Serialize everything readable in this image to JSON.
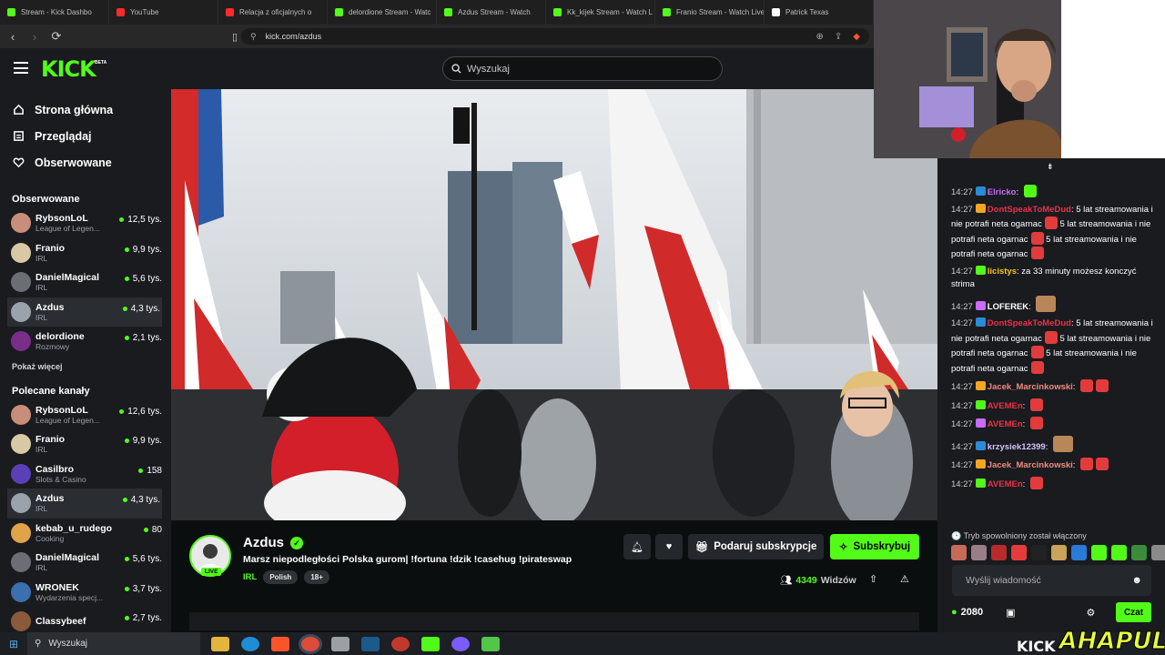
{
  "browser": {
    "tabs": [
      {
        "label": "Stream - Kick Dashbo",
        "color": "#53fc18"
      },
      {
        "label": "YouTube",
        "color": "#ff2a2a"
      },
      {
        "label": "Relacja z oficjalnych o",
        "color": "#ff2a2a"
      },
      {
        "label": "delordione Stream - Watc",
        "color": "#53fc18"
      },
      {
        "label": "Azdus Stream - Watch",
        "color": "#53fc18"
      },
      {
        "label": "Kk_kijek Stream - Watch L",
        "color": "#53fc18"
      },
      {
        "label": "Franio Stream - Watch Live",
        "color": "#53fc18"
      },
      {
        "label": "Patrick Texas",
        "color": "#ffffff"
      }
    ],
    "url": "kick.com/azdus"
  },
  "header": {
    "logo": "KICK",
    "logo_badge": "BETA",
    "search_placeholder": "Wyszukaj"
  },
  "sidebar": {
    "nav": [
      {
        "label": "Strona główna",
        "icon": "home-icon"
      },
      {
        "label": "Przeglądaj",
        "icon": "browse-icon"
      },
      {
        "label": "Obserwowane",
        "icon": "heart-icon"
      }
    ],
    "followed_heading": "Obserwowane",
    "followed": [
      {
        "name": "RybsonLoL",
        "category": "League of Legen...",
        "viewers": "12,5 tys.",
        "color": "#c98e7a"
      },
      {
        "name": "Franio",
        "category": "IRL",
        "viewers": "9,9 tys.",
        "color": "#d8c9a4"
      },
      {
        "name": "DanielMagical",
        "category": "IRL",
        "viewers": "5,6 tys.",
        "color": "#6b6e74"
      },
      {
        "name": "Azdus",
        "category": "IRL",
        "viewers": "4,3 tys.",
        "color": "#9aa3ab"
      },
      {
        "name": "delordione",
        "category": "Rozmowy",
        "viewers": "2,1 tys.",
        "color": "#7a2e8a"
      }
    ],
    "show_more": "Pokaż więcej",
    "recommended_heading": "Polecane kanały",
    "recommended": [
      {
        "name": "RybsonLoL",
        "category": "League of Legen...",
        "viewers": "12,6 tys.",
        "color": "#c98e7a"
      },
      {
        "name": "Franio",
        "category": "IRL",
        "viewers": "9,9 tys.",
        "color": "#d8c9a4"
      },
      {
        "name": "Casilbro",
        "category": "Slots & Casino",
        "viewers": "158",
        "color": "#5a3fb5"
      },
      {
        "name": "Azdus",
        "category": "IRL",
        "viewers": "4,3 tys.",
        "color": "#9aa3ab"
      },
      {
        "name": "kebab_u_rudego",
        "category": "Cooking",
        "viewers": "80",
        "color": "#e0a34a"
      },
      {
        "name": "DanielMagical",
        "category": "IRL",
        "viewers": "5,6 tys.",
        "color": "#6b6e74"
      },
      {
        "name": "WRONEK",
        "category": "Wydarzenia specj...",
        "viewers": "3,7 tys.",
        "color": "#3b6fb0"
      },
      {
        "name": "Classybeef",
        "category": "",
        "viewers": "2,7 tys.",
        "color": "#8a5a3a"
      }
    ]
  },
  "stream": {
    "streamer": "Azdus",
    "live_label": "LIVE",
    "title": "Marsz niepodległości Polska gurom| !fortuna !dzik !casehug !pirateswap",
    "category": "IRL",
    "tags": [
      "Polish",
      "18+"
    ],
    "gift_label": "Podaruj subskrypcje",
    "subscribe_label": "Subskrybuj",
    "viewers": "4349",
    "viewers_label": "Widzów"
  },
  "chat": {
    "messages": [
      {
        "time": "14:27",
        "user": "Elricko",
        "user_color": "#c96bff",
        "text": "",
        "emotes": [
          "green"
        ]
      },
      {
        "time": "14:27",
        "user": "DontSpeakToMeDud",
        "user_color": "#e8334a",
        "text": "5 lat streamowania i nie potrafi neta ogarnac",
        "emotes": [
          "red"
        ],
        "text2": "5 lat streamowania i nie potrafi neta ogarnac",
        "text3": "5 lat streamowania i nie potrafi neta ogarnac"
      },
      {
        "time": "14:27",
        "user": "licistys",
        "user_color": "#f5c518",
        "text": "za 33 minuty możesz konczyć strima",
        "emotes": []
      },
      {
        "time": "14:27",
        "user": "LOFEREK",
        "user_color": "#ffffff",
        "text": "",
        "emotes": [
          "face"
        ]
      },
      {
        "time": "14:27",
        "user": "DontSpeakToMeDud",
        "user_color": "#e8334a",
        "text": "5 lat streamowania i nie potrafi neta ogarnac",
        "emotes": [
          "red"
        ],
        "text2": "5 lat streamowania i nie potrafi neta ogarnac",
        "text3": "5 lat streamowania i nie potrafi neta ogarnac"
      },
      {
        "time": "14:27",
        "user": "Jacek_Marcinkowski",
        "user_color": "#ef8b7e",
        "text": "",
        "emotes": [
          "red",
          "red"
        ]
      },
      {
        "time": "14:27",
        "user": "AVEMEn",
        "user_color": "#e8334a",
        "text": "",
        "emotes": [
          "red"
        ]
      },
      {
        "time": "14:27",
        "user": "AVEMEn",
        "user_color": "#e8334a",
        "text": "",
        "emotes": [
          "red"
        ]
      },
      {
        "time": "14:27",
        "user": "krzysiek12399",
        "user_color": "#d4c1ff",
        "text": "",
        "emotes": [
          "face"
        ]
      },
      {
        "time": "14:27",
        "user": "Jacek_Marcinkowski",
        "user_color": "#ef8b7e",
        "text": "",
        "emotes": [
          "red",
          "red"
        ]
      },
      {
        "time": "14:27",
        "user": "AVEMEn",
        "user_color": "#e8334a",
        "text": "",
        "emotes": [
          "red"
        ]
      }
    ],
    "slow_mode_notice": "Tryb spowolniony został włączony",
    "input_placeholder": "Wyślij wiadomość",
    "points": "2080",
    "chat_button": "Czat"
  },
  "taskbar": {
    "search_label": "Wyszukaj"
  },
  "watermark": {
    "kick": "KICK",
    "ahapulco": "AHAPULCO"
  }
}
